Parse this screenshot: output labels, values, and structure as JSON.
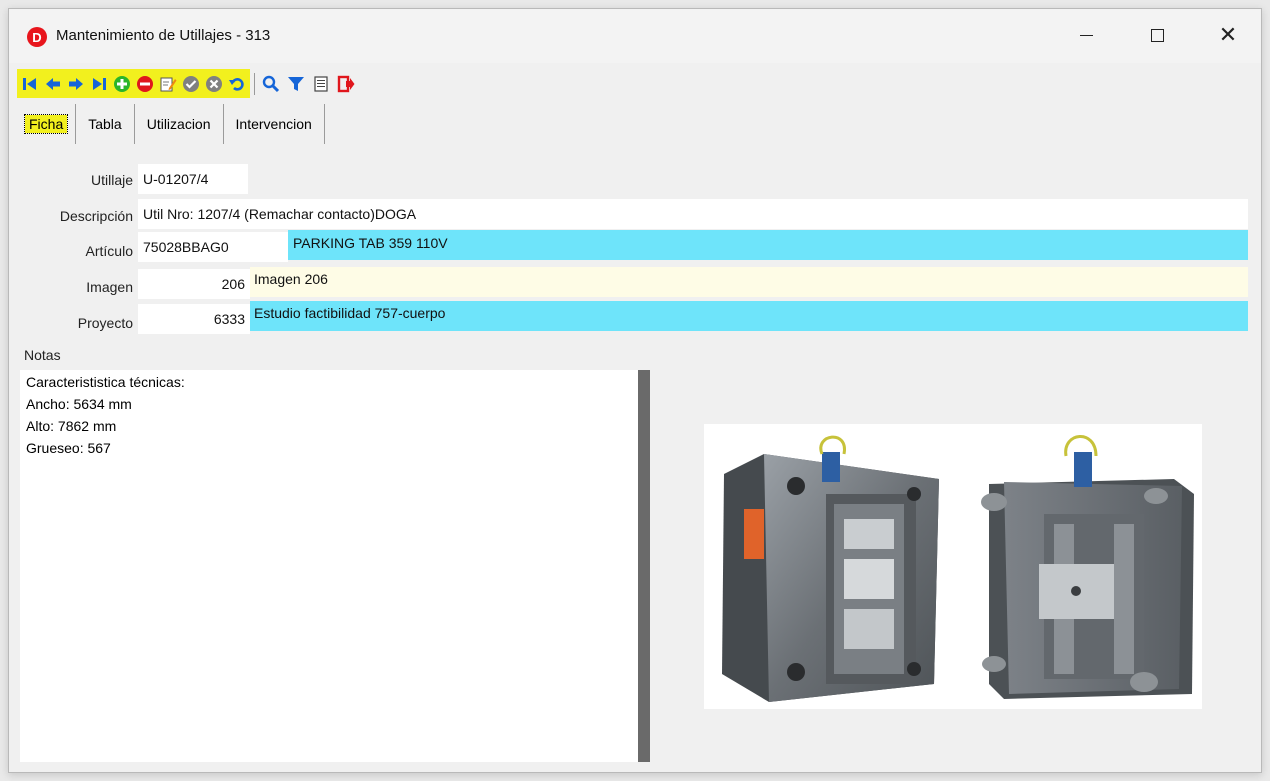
{
  "window": {
    "app_icon_letter": "D",
    "title": "Mantenimiento de Utillajes -  313",
    "accent": "#e8151c"
  },
  "toolbar": {
    "highlight_color": "#f2f01e",
    "buttons": [
      "first-icon",
      "previous-icon",
      "next-icon",
      "last-icon",
      "add-icon",
      "delete-icon",
      "edit-icon",
      "confirm-icon",
      "cancel-icon",
      "undo-icon",
      "search-icon",
      "filter-icon",
      "report-icon",
      "exit-icon"
    ]
  },
  "tabs": [
    {
      "label": "Ficha",
      "active": true
    },
    {
      "label": "Tabla",
      "active": false
    },
    {
      "label": "Utilizacion",
      "active": false
    },
    {
      "label": "Intervencion",
      "active": false
    }
  ],
  "form": {
    "utillaje": {
      "label": "Utillaje",
      "value": "U-01207/4"
    },
    "descripcion": {
      "label": "Descripción",
      "value": "Util Nro: 1207/4 (Remachar contacto)DOGA"
    },
    "articulo": {
      "label": "Artículo",
      "code": "75028BBAG0",
      "name": "PARKING TAB 359 110V"
    },
    "imagen": {
      "label": "Imagen",
      "code": "206",
      "name": "Imagen 206"
    },
    "proyecto": {
      "label": "Proyecto",
      "code": "6333",
      "name": "Estudio factibilidad 757-cuerpo"
    },
    "colors": {
      "lookup": "#6ee4fa",
      "image": "#fefce6"
    }
  },
  "notes": {
    "label": "Notas",
    "lines": [
      "Caracterististica técnicas:",
      "Ancho: 5634 mm",
      "Alto: 7862 mm",
      "Grueseo: 567"
    ]
  }
}
